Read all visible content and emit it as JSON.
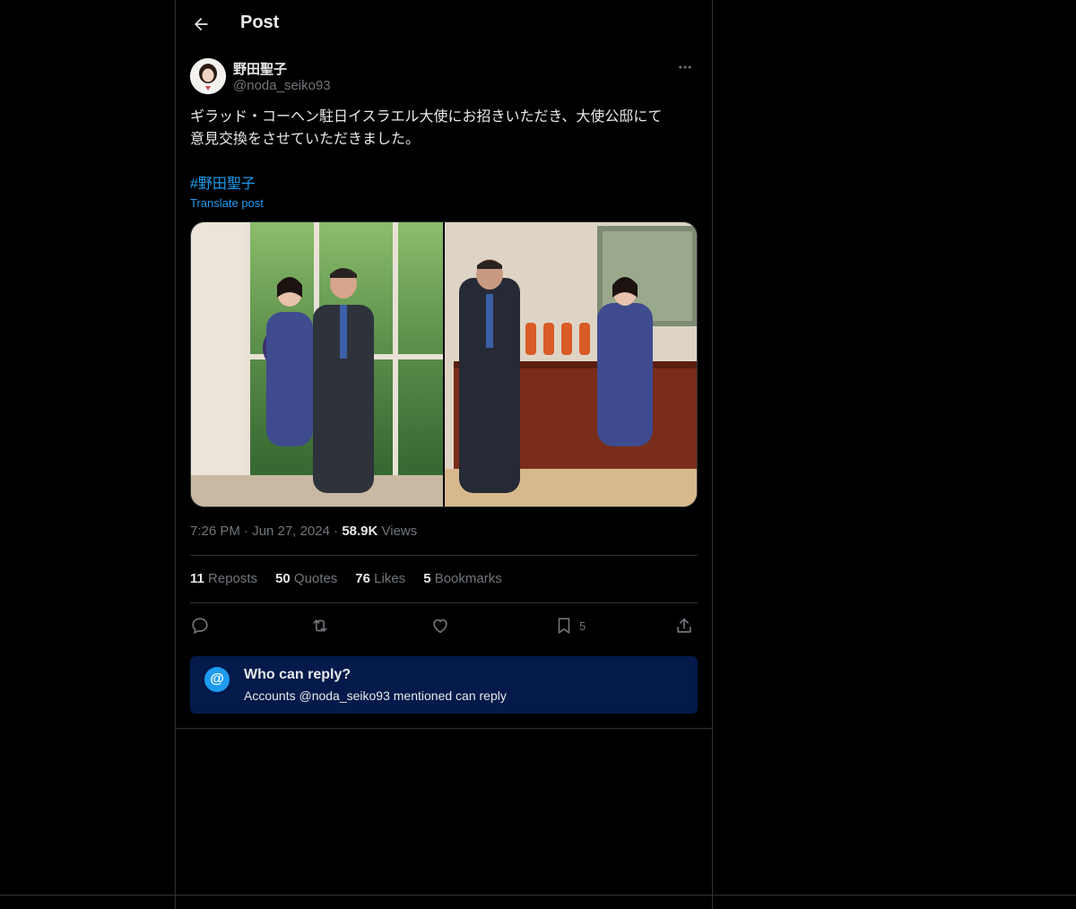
{
  "header": {
    "title": "Post",
    "back_icon": "arrow-left-icon"
  },
  "author": {
    "display_name": "野田聖子",
    "handle": "@noda_seiko93"
  },
  "post": {
    "text": "ギラッド・コーヘン駐日イスラエル大使にお招きいただき、大使公邸にて\n意見交換をさせていただきました。",
    "hashtag": "#野田聖子",
    "translate_label": "Translate post",
    "time": "7:26 PM",
    "sep1": "·",
    "date": "Jun 27, 2024",
    "sep2": "·",
    "views_count": "58.9K",
    "views_label": "Views"
  },
  "stats": [
    {
      "count": "11",
      "label": "Reposts"
    },
    {
      "count": "50",
      "label": "Quotes"
    },
    {
      "count": "76",
      "label": "Likes"
    },
    {
      "count": "5",
      "label": "Bookmarks"
    }
  ],
  "actions": {
    "bookmark_count": "5"
  },
  "reply_restriction": {
    "icon_glyph": "@",
    "title": "Who can reply?",
    "subtitle": "Accounts @noda_seiko93 mentioned can reply"
  },
  "colors": {
    "background": "#000000",
    "text_primary": "#e7e9ea",
    "text_secondary": "#71767b",
    "accent": "#1d9bf0",
    "reply_box_bg": "#031a4a",
    "border": "#2f3336"
  }
}
